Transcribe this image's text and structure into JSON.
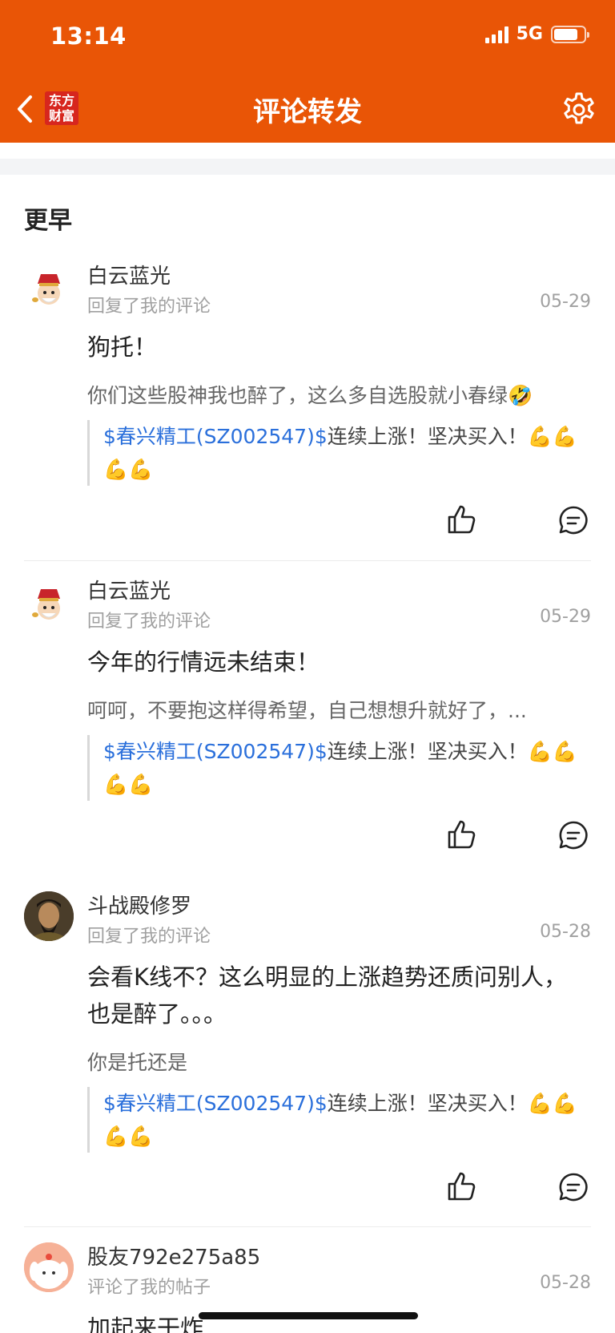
{
  "status_bar": {
    "time": "13:14",
    "network": "5G"
  },
  "nav": {
    "logo_text_line1": "东方",
    "logo_text_line2": "财富",
    "title": "评论转发"
  },
  "section_title": "更早",
  "colors": {
    "brand": "#e95506",
    "link": "#2a6fdb"
  },
  "items": [
    {
      "avatar_icon": "fortune-god-avatar",
      "username": "白云蓝光",
      "action": "回复了我的评论",
      "date": "05-29",
      "reply": "狗托！",
      "original": "你们这些股神我也醉了，这么多自选股就小春绿🤣",
      "quote_stock": "$春兴精工(SZ002547)$",
      "quote_text": "连续上涨！坚决买入！💪💪💪💪"
    },
    {
      "avatar_icon": "fortune-god-avatar",
      "username": "白云蓝光",
      "action": "回复了我的评论",
      "date": "05-29",
      "reply": "今年的行情远未结束！",
      "original": "呵呵，不要抱这样得希望，自己想想升就好了，...",
      "quote_stock": "$春兴精工(SZ002547)$",
      "quote_text": "连续上涨！坚决买入！💪💪💪💪"
    },
    {
      "avatar_icon": "warrior-avatar",
      "username": "斗战殿修罗",
      "action": "回复了我的评论",
      "date": "05-28",
      "reply": "会看K线不？这么明显的上涨趋势还质问别人，也是醉了。。。",
      "original": "你是托还是",
      "quote_stock": "$春兴精工(SZ002547)$",
      "quote_text": "连续上涨！坚决买入！💪💪💪💪"
    },
    {
      "avatar_icon": "cartoon-dog-avatar",
      "username": "股友792e275a85",
      "action": "评论了我的帖子",
      "date": "05-28",
      "reply": "加起来干炸"
    }
  ]
}
